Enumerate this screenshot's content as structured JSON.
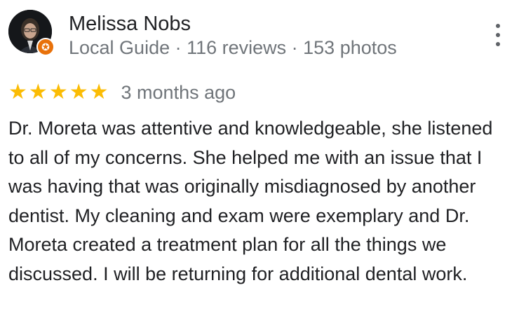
{
  "reviewer": {
    "name": "Melissa Nobs",
    "meta": "Local Guide · 116 reviews · 153 photos",
    "badge_icon": "local-guide-star-icon"
  },
  "review": {
    "rating": 5,
    "rating_max": 5,
    "star_glyph": "★",
    "date": "3 months ago",
    "text": "Dr. Moreta was attentive and knowledgeable, she listened to all of my concerns. She helped me with an issue that I was having that was originally misdiagnosed by another dentist. My cleaning and exam were exemplary and Dr. Moreta created a treatment plan for all the things we discussed. I will be returning for additional dental work."
  },
  "colors": {
    "star": "#fbbc04",
    "text": "#202124",
    "secondary_text": "#70757a",
    "badge": "#e8710a"
  }
}
